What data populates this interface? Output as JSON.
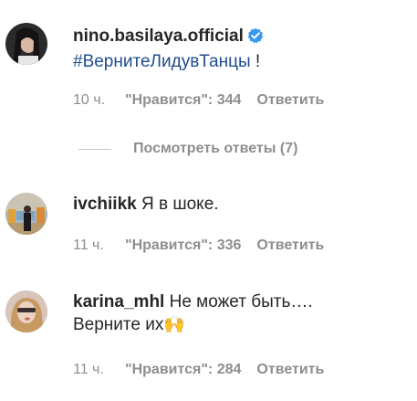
{
  "comments": [
    {
      "username": "nino.basilaya.official",
      "verified": true,
      "hashtag": "#ВернитеЛидувТанцы",
      "text": " !",
      "time": "10 ч.",
      "likes": "\"Нравится\": 344",
      "reply": "Ответить",
      "view_replies": "Посмотреть ответы (7)"
    },
    {
      "username": "ivchiikk",
      "text": "Я в шоке.",
      "time": "11 ч.",
      "likes": "\"Нравится\": 336",
      "reply": "Ответить"
    },
    {
      "username": "karina_mhl",
      "text": "Не может быть….",
      "text_line2": "Верните их🙌",
      "time": "11 ч.",
      "likes": "\"Нравится\": 284",
      "reply": "Ответить"
    }
  ],
  "colors": {
    "verified_badge": "#3897f0",
    "hashtag": "#1f4b8e",
    "meta_text": "#8e8e8e"
  }
}
